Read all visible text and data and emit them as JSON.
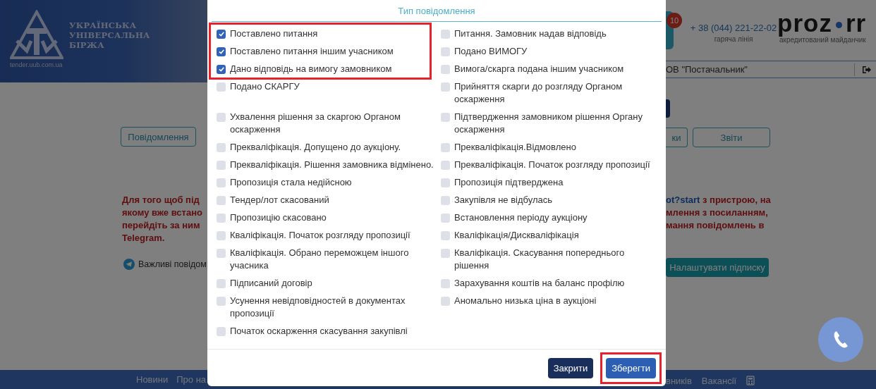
{
  "background_page": {
    "logo": {
      "lines": [
        "УКРАЇНСЬКА",
        "УНІВЕРСАЛЬНА",
        "БІРЖА"
      ],
      "site": "tender.uub.com.ua"
    },
    "notification_badge": "10",
    "hotline": {
      "phone": "+ 38 (044) 221-22-02",
      "label": "гаряча лінія"
    },
    "brand": {
      "name_start": "proz",
      "name_end": "rr",
      "caption": "акредитований майданчик"
    },
    "user": "ОВ \"Постачальник\"",
    "left_tabs": [
      "Повідомлення"
    ],
    "right_tabs": [
      "ки",
      "Звіти"
    ],
    "notice_left": [
      "Для того щоб під",
      "якому вже встано",
      "перейдіть за ним",
      "Telegram."
    ],
    "notice_right": [
      {
        "link": "ot?start",
        "text": " з пристрою, на"
      },
      {
        "text": "млення з посиланням,"
      },
      {
        "text": "мання повідомлень в"
      }
    ],
    "telegram_label": "Важливі повідом",
    "subscribe_button": "Налаштувати підписку",
    "footer_left": [
      "Новини",
      "Про на"
    ],
    "footer_right": [
      "вників",
      "Вакансії"
    ]
  },
  "modal": {
    "title": "Тип повідомлення",
    "left_column": [
      {
        "label": "Поставлено питання",
        "checked": true,
        "highlighted": true
      },
      {
        "label": "Поставлено питання іншим учасником",
        "checked": true,
        "highlighted": true
      },
      {
        "label": "Дано відповідь на вимогу замовником",
        "checked": true,
        "highlighted": true
      },
      {
        "label": "Подано СКАРГУ",
        "checked": false,
        "highlighted": false
      },
      {
        "label": "Ухвалення рішення за скаргою Органом оскарження",
        "checked": false,
        "highlighted": false
      },
      {
        "label": "Прекваліфікація. Допущено до аукціону.",
        "checked": false,
        "highlighted": false
      },
      {
        "label": "Прекваліфікація. Рішення замовника відмінено.",
        "checked": false,
        "highlighted": false
      },
      {
        "label": "Пропозиція стала недійсною",
        "checked": false,
        "highlighted": false
      },
      {
        "label": "Тендер/лот скасований",
        "checked": false,
        "highlighted": false
      },
      {
        "label": "Пропозицію скасовано",
        "checked": false,
        "highlighted": false
      },
      {
        "label": "Кваліфікація. Початок розгляду пропозиції",
        "checked": false,
        "highlighted": false
      },
      {
        "label": "Кваліфікація. Обрано переможцем іншого учасника",
        "checked": false,
        "highlighted": false
      },
      {
        "label": "Підписаний договір",
        "checked": false,
        "highlighted": false
      },
      {
        "label": "Усунення невідповідностей в документах пропозиції",
        "checked": false,
        "highlighted": false
      },
      {
        "label": "Початок оскарження скасування закупівлі",
        "checked": false,
        "highlighted": false
      }
    ],
    "right_column": [
      {
        "label": "Питання. Замовник надав відповідь",
        "checked": false
      },
      {
        "label": "Подано ВИМОГУ",
        "checked": false
      },
      {
        "label": "Вимога/скарга подана іншим учасником",
        "checked": false
      },
      {
        "label": "Прийняття скарги до розгляду Органом оскарження",
        "checked": false
      },
      {
        "label": "Підтвердження замовником рішення Органу оскарження",
        "checked": false
      },
      {
        "label": "Прекваліфікація.Відмовлено",
        "checked": false
      },
      {
        "label": "Прекваліфікація. Початок розгляду пропозиції",
        "checked": false
      },
      {
        "label": "Пропозиція підтверджена",
        "checked": false
      },
      {
        "label": "Закупівля не відбулась",
        "checked": false
      },
      {
        "label": "Встановлення періоду аукціону",
        "checked": false
      },
      {
        "label": "Кваліфікація/Дискваліфікація",
        "checked": false
      },
      {
        "label": "Кваліфікація. Скасування попереднього рішення",
        "checked": false
      },
      {
        "label": "Зарахування коштів на баланс профілю",
        "checked": false
      },
      {
        "label": "Аномально низька ціна в аукціоні",
        "checked": false
      }
    ],
    "buttons": [
      {
        "label": "Закрити",
        "kind": "secondary",
        "highlighted": false
      },
      {
        "label": "Зберегти",
        "kind": "primary",
        "highlighted": true
      }
    ]
  }
}
